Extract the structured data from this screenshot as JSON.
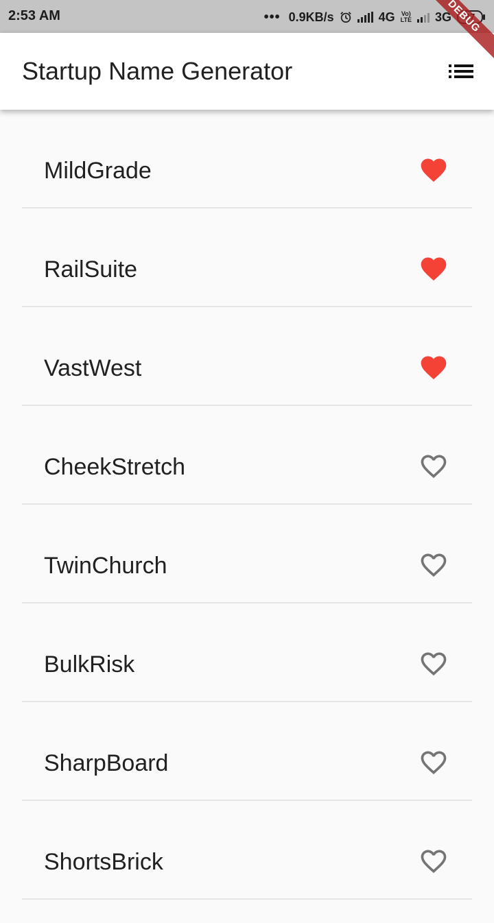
{
  "status_bar": {
    "time": "2:53 AM",
    "dots": "•••",
    "net_speed": "0.9KB/s",
    "network1": "4G",
    "volte_top": "Vo)",
    "volte_bottom": "LTE",
    "network2": "3G",
    "battery": "87"
  },
  "app_bar": {
    "title": "Startup Name Generator",
    "action_icon": "list-icon"
  },
  "debug_banner": "DEBUG",
  "colors": {
    "favorite": "#f44336",
    "unfavorite": "#757575"
  },
  "items": [
    {
      "name": "MildGrade",
      "favorite": true
    },
    {
      "name": "RailSuite",
      "favorite": true
    },
    {
      "name": "VastWest",
      "favorite": true
    },
    {
      "name": "CheekStretch",
      "favorite": false
    },
    {
      "name": "TwinChurch",
      "favorite": false
    },
    {
      "name": "BulkRisk",
      "favorite": false
    },
    {
      "name": "SharpBoard",
      "favorite": false
    },
    {
      "name": "ShortsBrick",
      "favorite": false
    }
  ]
}
